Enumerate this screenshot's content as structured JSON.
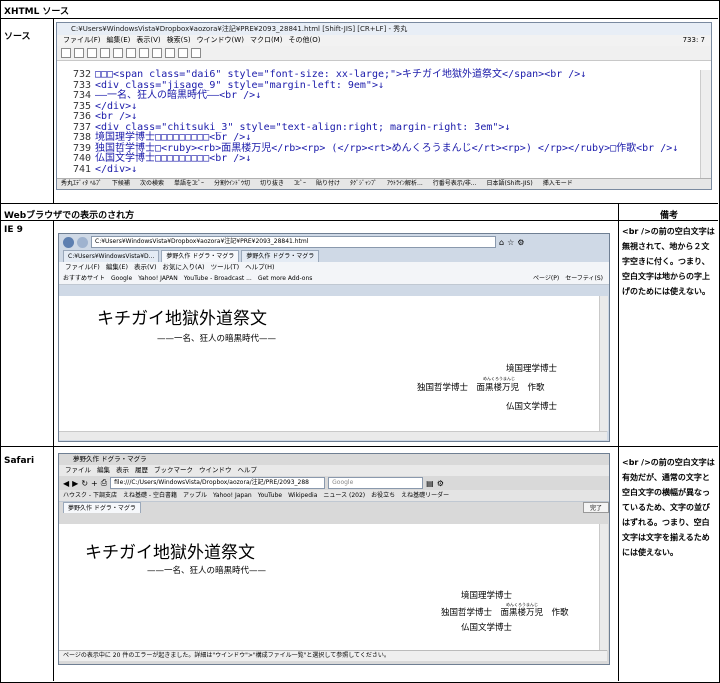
{
  "table": {
    "source_header": "XHTML ソース",
    "source_label": "ソース",
    "browser_header": "Webブラウザでの表示のされ方",
    "notes_header": "備考",
    "ie_label": "IE 9",
    "safari_label": "Safari",
    "ie_note": "<br />の前の空白文字は無視されて、地から２文字空きに付く。つまり、空白文字は地からの字上げのためには使えない。",
    "safari_note": "<br />の前の空白文字は有効だが、通常の文字と空白文字の横幅が異なっているため、文字の並びはずれる。つまり、空白文字は文字を揃えるためには使えない。"
  },
  "editor": {
    "title": "C:¥Users¥WindowsVista¥Dropbox¥aozora¥注記¥PRE¥2093_28841.html  [Shift-JIS]  [CR+LF] - 秀丸",
    "menu": [
      "ファイル(F)",
      "編集(E)",
      "表示(V)",
      "検索(S)",
      "ウインドウ(W)",
      "マクロ(M)",
      "その他(O)"
    ],
    "position": "733: 7",
    "lines": [
      {
        "n": "732",
        "t": "□□□<span class=\"dai6\" style=\"font-size: xx-large;\">キチガイ地獄外道祭文</span><br />↓"
      },
      {
        "n": "733",
        "t": "<div class=\"jisage_9\" style=\"margin-left: 9em\">↓"
      },
      {
        "n": "734",
        "t": "——一名、狂人の暗黒時代——<br />↓"
      },
      {
        "n": "735",
        "t": "</div>↓"
      },
      {
        "n": "736",
        "t": "<br />↓"
      },
      {
        "n": "737",
        "t": "<div class=\"chitsuki_3\" style=\"text-align:right; margin-right: 3em\">↓"
      },
      {
        "n": "738",
        "t": "境国理学博士□□□□□□□□□<br />↓"
      },
      {
        "n": "739",
        "t": "独国哲学博士□<ruby><rb>面黒楼万児</rb><rp> (</rp><rt>めんくろうまんじ</rt><rp>) </rp></ruby>□作歌<br />↓"
      },
      {
        "n": "740",
        "t": "仏国文学博士□□□□□□□□□<br />↓"
      },
      {
        "n": "741",
        "t": "</div>↓"
      }
    ],
    "status": [
      "秀丸ｴﾃﾞｨﾀ ﾍﾙﾌﾟ",
      "下候補",
      "次の検索",
      "単語をｺﾋﾟｰ",
      "分割ｳｲﾝﾄﾞｳ切",
      "切り抜き",
      "ｺﾋﾟｰ",
      "貼り付け",
      "ﾀｸﾞｼﾞｬﾝﾌﾟ",
      "ｱｳﾄﾗｲﾝ解析...",
      "行番号表示/非...",
      "日本語(Shift-JIS)",
      "挿入モード"
    ]
  },
  "ie": {
    "address": "C:¥Users¥WindowsVista¥Dropbox¥aozora¥注記¥PRE¥2093_28841.html",
    "tabs": [
      "C:¥Users¥WindowsVista¥D...",
      "夢野久作 ドグラ・マグラ",
      "夢野久作 ドグラ・マグラ"
    ],
    "menu": [
      "ファイル(F)",
      "編集(E)",
      "表示(V)",
      "お気に入り(A)",
      "ツール(T)",
      "ヘルプ(H)"
    ],
    "favorites": [
      "おすすめサイト",
      "Google",
      "Yahoo! JAPAN",
      "YouTube - Broadcast ...",
      "Get more Add-ons"
    ],
    "tools": [
      "ページ(P)",
      "セーフティ(S)"
    ],
    "content": {
      "title": "キチガイ地獄外道祭文",
      "subtitle": "——一名、狂人の暗黒時代——",
      "line1": "境国理学博士",
      "line2": "独国哲学博士　面黒楼万児　作歌",
      "ruby": "めんくろうまんじ",
      "line3": "仏国文学博士"
    }
  },
  "safari": {
    "window_title": "夢野久作 ドグラ・マグラ",
    "menu": [
      "ファイル",
      "編集",
      "表示",
      "履歴",
      "ブックマーク",
      "ウインドウ",
      "ヘルプ"
    ],
    "address": "file:///C:/Users/WindowsVista/Dropbox/aozora/注記/PRE/2093_288",
    "search_placeholder": "Google",
    "bookmarks": [
      "ハウスク - 下調支店",
      "えね基礎 - 空白書籍",
      "アップル",
      "Yahoo! Japan",
      "YouTube",
      "Wikipedia",
      "ニュース (202)",
      "お役立ち",
      "えね基礎リーダー"
    ],
    "tab": "夢野久作 ドグラ・マグラ",
    "find_done": "完了",
    "content": {
      "title": "キチガイ地獄外道祭文",
      "subtitle": "——一名、狂人の暗黒時代——",
      "line1": "境国理学博士",
      "line2": "独国哲学博士　面黒楼万児　作歌",
      "ruby": "めんくろうまんじ",
      "line3": "仏国文学博士"
    },
    "status": "ページの表示中に 20 件のエラーが起きました。詳細は\"ウインドウ\">\"構成ファイル一覧\"と選択して参照してください。"
  }
}
